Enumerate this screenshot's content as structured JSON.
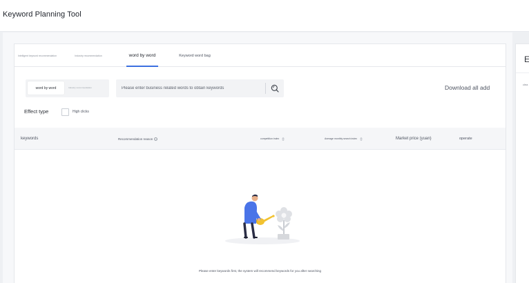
{
  "app": {
    "title": "Keyword Planning Tool"
  },
  "tabs": [
    {
      "label": "Intelligent keyword recommendation",
      "active": false
    },
    {
      "label": "Industry recommendation",
      "active": false
    },
    {
      "label": "word by word",
      "active": true
    },
    {
      "label": "Keyword word bag",
      "active": false
    }
  ],
  "search": {
    "mode_active": "word by word",
    "mode_alt": "Industry recommendation",
    "placeholder": "Please enter business related words to obtain keywords",
    "value": "",
    "search_icon": "search-icon"
  },
  "download_label": "Download all add",
  "filter": {
    "label": "Effect type",
    "option_label": "High clicks",
    "checked": false
  },
  "table": {
    "columns": {
      "keywords": "keywords",
      "reason": "Recommendation reason",
      "competition": "competition index",
      "avg_search": "Average monthly search index",
      "market_price": "Market price (yuan)",
      "operate": "operate"
    },
    "rows": []
  },
  "empty_state": {
    "message": "Please enter keywords first, the system will recommend keywords for you after searching"
  },
  "side_panel": {
    "tab_char": "E",
    "text": "clea"
  },
  "colors": {
    "accent": "#3b6fe0",
    "illustration_blue": "#4a74e8",
    "illustration_yellow": "#f2c230"
  }
}
